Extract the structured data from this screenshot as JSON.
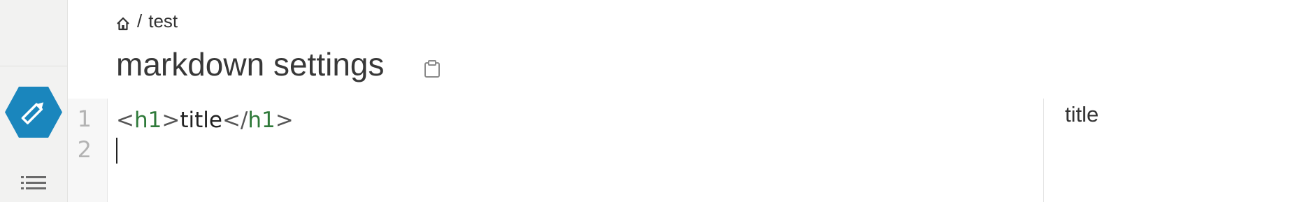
{
  "breadcrumb": {
    "separator": "/",
    "current": "test"
  },
  "document": {
    "title": "markdown settings"
  },
  "editor": {
    "line_numbers": [
      "1",
      "2"
    ],
    "line1": {
      "open_lt": "<",
      "open_tag": "h1",
      "open_gt": ">",
      "text": "title",
      "close_lt": "</",
      "close_tag": "h1",
      "close_gt": ">"
    },
    "line2": ""
  },
  "preview": {
    "heading": "title"
  },
  "icons": [
    "home-icon",
    "clipboard-icon",
    "pencil-icon",
    "list-icon"
  ],
  "colors": {
    "accent": "#1a86bd",
    "sidebar_bg": "#f2f2f1",
    "tag": "#2f7a3a"
  }
}
